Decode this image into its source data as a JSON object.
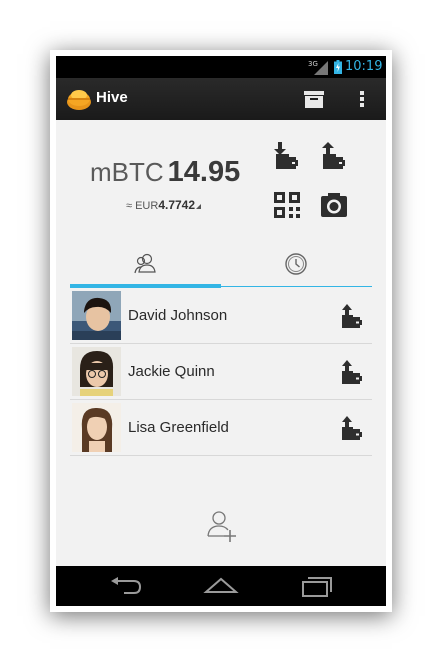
{
  "status_bar": {
    "time": "10:19",
    "network": "3G"
  },
  "action_bar": {
    "title": "Hive",
    "actions": [
      {
        "name": "archive",
        "icon": "archive-icon"
      },
      {
        "name": "overflow",
        "icon": "overflow-menu-icon"
      }
    ]
  },
  "balance": {
    "unit": "mBTC",
    "amount": "14.95",
    "fiat_prefix": "≈ EUR",
    "fiat_amount": "4.7742"
  },
  "wallet_actions": [
    {
      "name": "receive",
      "icon": "wallet-receive-icon"
    },
    {
      "name": "send",
      "icon": "wallet-send-icon"
    },
    {
      "name": "scan-qr",
      "icon": "qr-code-icon"
    },
    {
      "name": "camera",
      "icon": "camera-icon"
    }
  ],
  "tabs": [
    {
      "name": "contacts",
      "icon": "contacts-icon",
      "selected": true
    },
    {
      "name": "history",
      "icon": "clock-icon",
      "selected": false
    }
  ],
  "contacts": [
    {
      "name": "David Johnson",
      "avatar": "avatar-photo"
    },
    {
      "name": "Jackie Quinn",
      "avatar": "avatar-photo"
    },
    {
      "name": "Lisa Greenfield",
      "avatar": "avatar-photo"
    }
  ],
  "add_contact": {
    "icon": "add-contact-icon"
  },
  "nav_bar": [
    {
      "name": "back",
      "icon": "back-icon"
    },
    {
      "name": "home",
      "icon": "home-icon"
    },
    {
      "name": "recent-apps",
      "icon": "recent-apps-icon"
    }
  ],
  "colors": {
    "accent": "#33b5e5",
    "action_bar": "#1f1f1f",
    "content_bg": "#f2f2f2",
    "logo": "#f5a623"
  }
}
